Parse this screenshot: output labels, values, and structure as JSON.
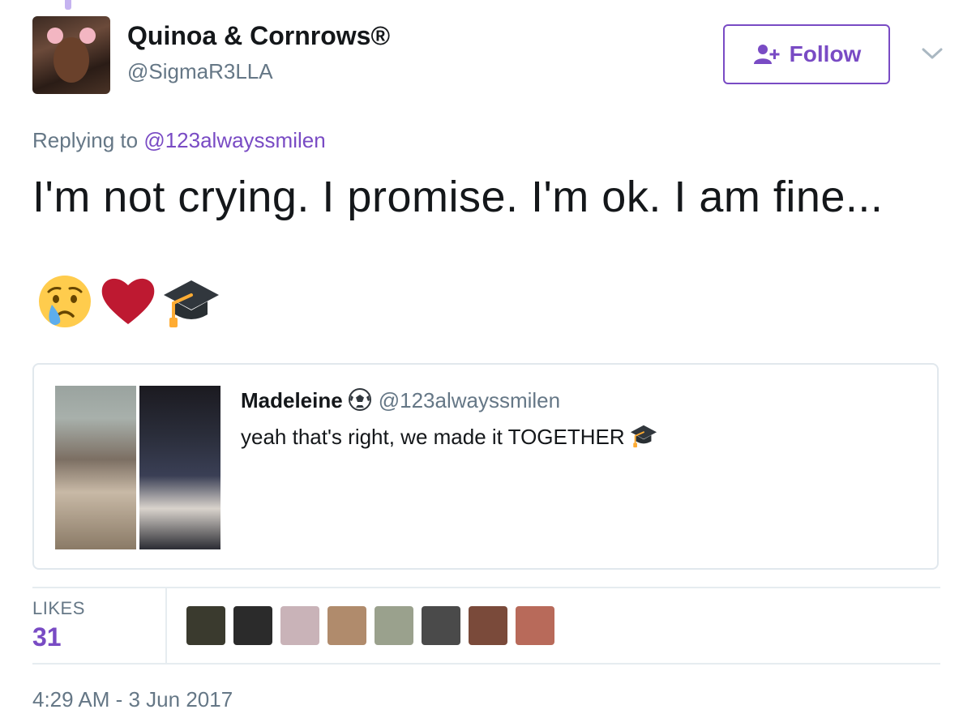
{
  "user": {
    "display_name": "Quinoa & Cornrows®",
    "handle": "@SigmaR3LLA",
    "avatar": "user-avatar"
  },
  "follow_button": {
    "label": "Follow",
    "icon": "add-user-icon",
    "color": "#794bc4"
  },
  "menu_icon": "chevron-down-icon",
  "reply": {
    "prefix": "Replying to ",
    "mention": "@123alwayssmilen"
  },
  "tweet": {
    "text": "I'm not crying. I promise. I'm ok. I am fine...",
    "emojis": [
      "crying-face-emoji",
      "red-heart-emoji",
      "graduation-cap-emoji"
    ]
  },
  "quoted_tweet": {
    "name": "Madeleine",
    "name_emoji": "soccer-ball-emoji",
    "handle": "@123alwayssmilen",
    "text": "yeah that's right, we made it TOGETHER",
    "text_emoji": "graduation-cap-emoji",
    "images": [
      "graduation-photo-1",
      "graduation-photo-2"
    ]
  },
  "stats": {
    "likes_label": "LIKES",
    "likes_count": "31",
    "likers": [
      {
        "name": "liker-avatar-1",
        "color": "#3a3a2e"
      },
      {
        "name": "liker-avatar-2",
        "color": "#2b2b2b"
      },
      {
        "name": "liker-avatar-3",
        "color": "#c9b3b8"
      },
      {
        "name": "liker-avatar-4",
        "color": "#b08b6c"
      },
      {
        "name": "liker-avatar-5",
        "color": "#9aa18d"
      },
      {
        "name": "liker-avatar-6",
        "color": "#4a4a4a"
      },
      {
        "name": "liker-avatar-7",
        "color": "#7a4a3a"
      },
      {
        "name": "liker-avatar-8",
        "color": "#b86a5a"
      }
    ]
  },
  "timestamp": "4:29 AM - 3 Jun 2017",
  "colors": {
    "accent": "#794bc4",
    "secondary_text": "#657786",
    "border": "#e1e8ed"
  }
}
